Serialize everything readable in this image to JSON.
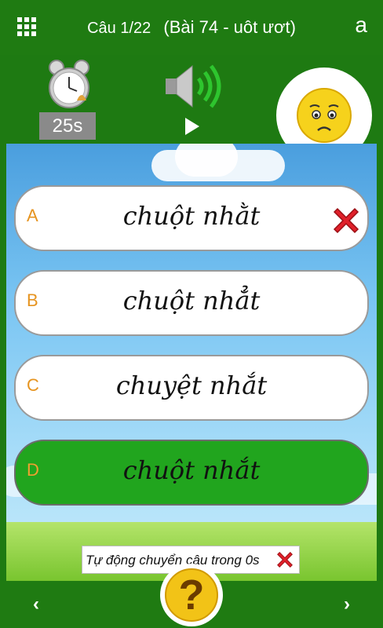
{
  "header": {
    "question_counter": "Câu 1/22",
    "lesson_title": "(Bài 74 - uôt ươt)",
    "font_toggle": "a"
  },
  "timer": {
    "label": "25s"
  },
  "answers": [
    {
      "letter": "A",
      "text": "chuột nhằt",
      "state": "wrong"
    },
    {
      "letter": "B",
      "text": "chuột nhẳt",
      "state": "normal"
    },
    {
      "letter": "C",
      "text": "chuyệt nhắt",
      "state": "normal"
    },
    {
      "letter": "D",
      "text": "chuột nhắt",
      "state": "correct"
    }
  ],
  "auto_next": {
    "text": "Tự động chuyển câu trong 0s"
  },
  "nav": {
    "prev": "‹",
    "next": "›",
    "help": "?"
  },
  "colors": {
    "bar": "#1f7b12",
    "correct": "#21a51e",
    "label": "#e69420",
    "wrong_x": "#e0202a"
  }
}
